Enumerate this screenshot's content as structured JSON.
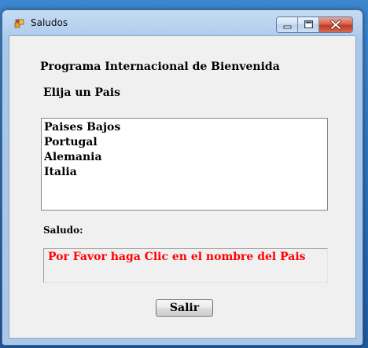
{
  "window": {
    "title": "Saludos",
    "app_icon": "windows-forms-app-icon",
    "caption_buttons": [
      "minimize-icon",
      "maximize-icon",
      "close-icon"
    ]
  },
  "form": {
    "program_title": "Programa Internacional de Bienvenida",
    "choose_label": "Elija un Pais",
    "countries": [
      "Paises Bajos",
      "Portugal",
      "Alemania",
      "Italia"
    ],
    "greeting_label": "Saludo:",
    "greeting_message": "Por Favor haga Clic en el nombre del Pais",
    "exit_button": "Salir"
  },
  "colors": {
    "message_text": "#ff0000",
    "form_background": "#f0f0f0",
    "close_button": "#c23a22"
  }
}
